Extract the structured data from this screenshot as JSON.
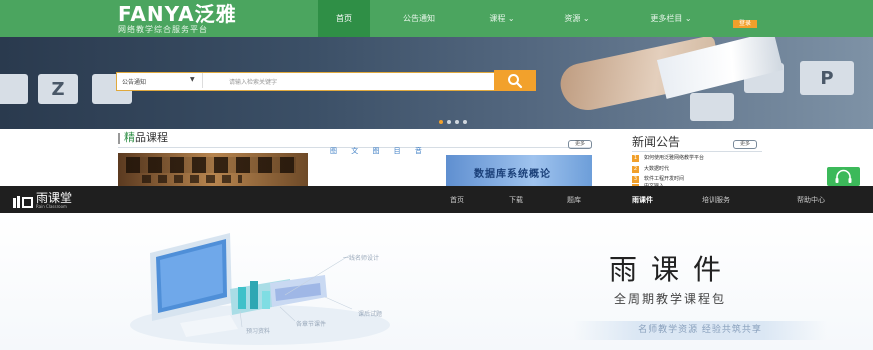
{
  "fanya": {
    "logo": "FANYA泛雅",
    "logo_sub": "网络教学综合服务平台",
    "nav": [
      {
        "label": "首页",
        "active": true
      },
      {
        "label": "公告通知"
      },
      {
        "label": "课程 ⌄"
      },
      {
        "label": "资源 ⌄"
      },
      {
        "label": "更多栏目 ⌄"
      }
    ],
    "badge": "登录",
    "search": {
      "select_value": "公告通知",
      "placeholder": "请输入检索关键字"
    },
    "banner_keys": [
      "Z",
      "P"
    ],
    "featured": {
      "title_accent": "精",
      "title_rest": "品课程",
      "tabs": "图 文 图 目 音",
      "more": "更多",
      "course_image_text": "数据库系统概论"
    },
    "news": {
      "title": "新闻公告",
      "more": "更多",
      "items": [
        "如何使用泛雅网络教学平台",
        "大数据时代",
        "软件工程开发时间",
        "中文输入"
      ]
    }
  },
  "yuketang": {
    "logo": "雨课堂",
    "logo_sub": "Rain Classroom",
    "nav": [
      {
        "label": "首页"
      },
      {
        "label": "下载"
      },
      {
        "label": "题库"
      },
      {
        "label": "雨课件",
        "active": true
      },
      {
        "label": "培训服务"
      },
      {
        "label": "帮助中心"
      }
    ],
    "hero": {
      "title": "雨课件",
      "subtitle": "全周期教学课程包",
      "slogan": "名师教学资源  经验共筑共享",
      "illustration_captions": {
        "designer": "一线名师设计",
        "exercises": "课后试题",
        "courseware": "各章节课件",
        "preview": "预习资料"
      }
    }
  },
  "colors": {
    "fanya_green": "#4ba55f",
    "fanya_orange": "#f2a12c",
    "yuketang_bar": "#1f1f1f"
  }
}
